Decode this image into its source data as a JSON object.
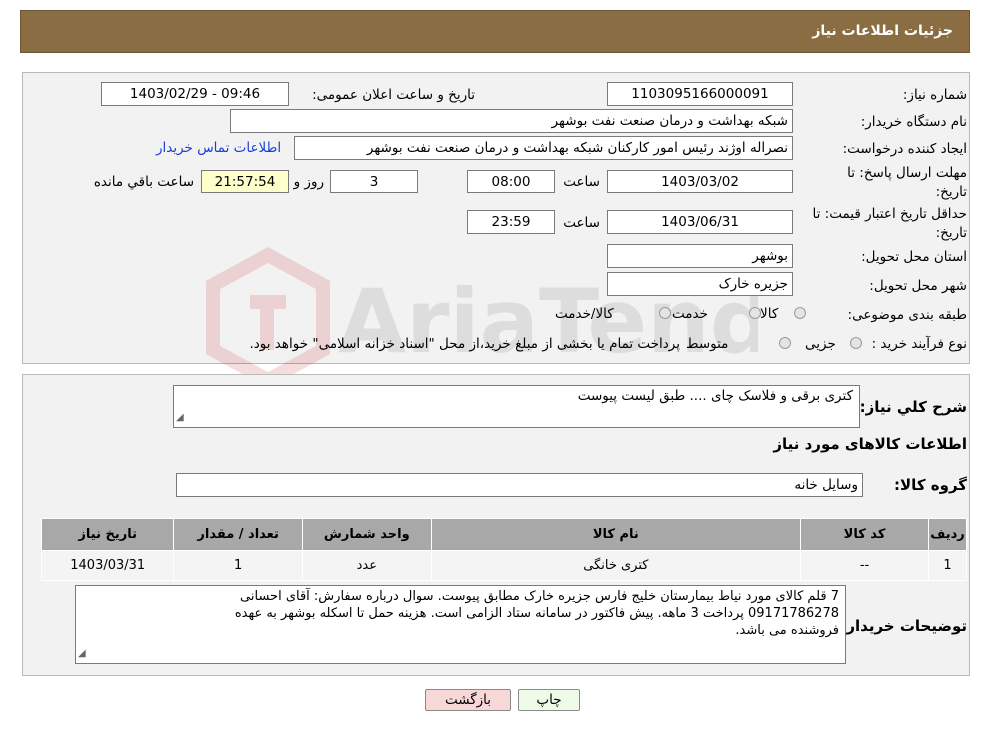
{
  "header": {
    "title": "جزئیات اطلاعات نیاز"
  },
  "form": {
    "need_number_label": "شماره نیاز:",
    "need_number": "1103095166000091",
    "announce_label": "تاریخ و ساعت اعلان عمومی:",
    "announce_value": "1403/02/29 - 09:46",
    "buyer_label": "نام دستگاه خریدار:",
    "buyer_value": "شبکه بهداشت و درمان صنعت نفت بوشهر",
    "creator_label": "ایجاد کننده درخواست:",
    "creator_value": "نصراله اوژند رئیس امور کارکنان شبکه بهداشت و درمان صنعت نفت بوشهر",
    "contact_link": "اطلاعات تماس خریدار",
    "deadline_label_line1": "مهلت ارسال پاسخ: تا",
    "deadline_label_line2": "تاریخ:",
    "deadline_date": "1403/03/02",
    "time_label": "ساعت",
    "deadline_time": "08:00",
    "days_value": "3",
    "days_label": "روز و",
    "remaining_time": "21:57:54",
    "remaining_label": "ساعت باقي مانده",
    "validity_label_line1": "حداقل تاریخ اعتبار قیمت: تا",
    "validity_label_line2": "تاریخ:",
    "validity_date": "1403/06/31",
    "validity_time": "23:59",
    "province_label": "استان محل تحویل:",
    "province_value": "بوشهر",
    "city_label": "شهر محل تحویل:",
    "city_value": "جزیره خارک",
    "category_label": "طبقه بندی موضوعی:",
    "category_options": [
      "کالا",
      "خدمت",
      "کالا/خدمت"
    ],
    "process_label": "نوع فرآیند خرید :",
    "process_options": [
      "جزیی",
      "متوسط"
    ],
    "process_note": "پرداخت تمام یا بخشی از مبلغ خرید،از محل \"اسناد خزانه اسلامی\" خواهد بود."
  },
  "details": {
    "summary_label": "شرح کلي نياز:",
    "summary_value": "کتری برقی و فلاسک چای .... طبق لیست پیوست",
    "items_heading": "اطلاعات کالاهای مورد نیاز",
    "group_label": "گروه کالا:",
    "group_value": "وسایل خانه",
    "table": {
      "headers": [
        "ردیف",
        "کد کالا",
        "نام کالا",
        "واحد شمارش",
        "تعداد / مقدار",
        "تاریخ نیاز"
      ],
      "rows": [
        [
          "1",
          "--",
          "کتری خانگی",
          "عدد",
          "1",
          "1403/03/31"
        ]
      ]
    },
    "buyer_notes_label": "توضیحات خریدار:",
    "buyer_notes_line1": "7 قلم کالای مورد نیاط بیمارستان خلیج فارس جزیره خارک مطابق پیوست. سوال درباره سفارش:  آقای احسانی",
    "buyer_notes_line2": "09171786278 پرداخت 3 ماهه. پیش فاکتور در سامانه ستاد الزامی است. هزینه حمل تا اسکله بوشهر به عهده",
    "buyer_notes_line3": "فروشنده می باشد."
  },
  "buttons": {
    "print": "چاپ",
    "back": "بازگشت"
  },
  "watermark": {
    "text": "AriaTender.neT"
  },
  "colors": {
    "header_bg": "#8b6d44",
    "link": "#1a3fd8",
    "back_button": "#f8d7d7",
    "print_button": "#eefbe8"
  }
}
